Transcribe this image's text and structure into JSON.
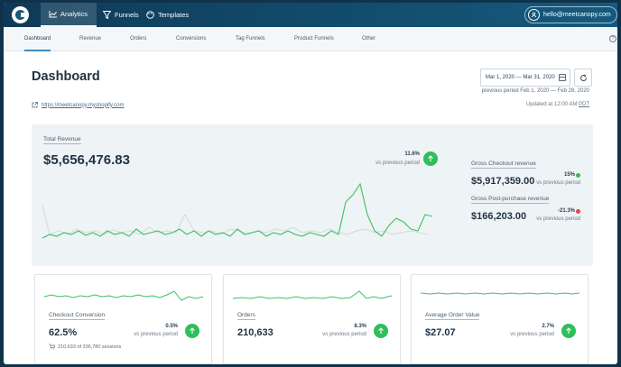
{
  "topbar": {
    "nav": [
      {
        "label": "Analytics",
        "icon": "chart-line-icon",
        "active": true
      },
      {
        "label": "Funnels",
        "icon": "funnel-icon"
      },
      {
        "label": "Templates",
        "icon": "palette-icon"
      }
    ],
    "account_email": "hello@meetcanopy.com"
  },
  "subnav": [
    "Dashboard",
    "Revenue",
    "Orders",
    "Conversions",
    "Tag Funnels",
    "Product Funnels",
    "Other"
  ],
  "header": {
    "title": "Dashboard",
    "date_range": "Mar 1, 2020 — Mar 31, 2020",
    "previous_period": "previous period Feb 1, 2020 — Feb 28, 2020",
    "store_url": "https://meetcanopy.myshopify.com",
    "updated_prefix": "Updated at 12:00 AM",
    "updated_tz": "PDT"
  },
  "revenue": {
    "label": "Total Revenue",
    "value": "$5,656,476.83",
    "change": "11.6%",
    "vs": "vs previous period",
    "gross_checkout": {
      "label": "Gross Checkout revenue",
      "value": "$5,917,359.00",
      "change": "15%",
      "vs": "vs previous period"
    },
    "gross_post": {
      "label": "Gross Post-purchase revenue",
      "value": "$166,203.00",
      "change": "-21.3%",
      "vs": "vs previous period"
    }
  },
  "cards": [
    {
      "label": "Checkout Conversion",
      "value": "62.5%",
      "change": "0.5%",
      "vs": "vs previous period",
      "sessions": "210,633 of 336,780 sessions"
    },
    {
      "label": "Orders",
      "value": "210,633",
      "change": "8.3%",
      "vs": "vs previous period"
    },
    {
      "label": "Average Order Value",
      "value": "$27.07",
      "change": "2.7%",
      "vs": "vs previous period"
    }
  ],
  "colors": {
    "accent_green": "#2fbe5a",
    "negative_red": "#e04848",
    "topbar": "#155a7e"
  }
}
